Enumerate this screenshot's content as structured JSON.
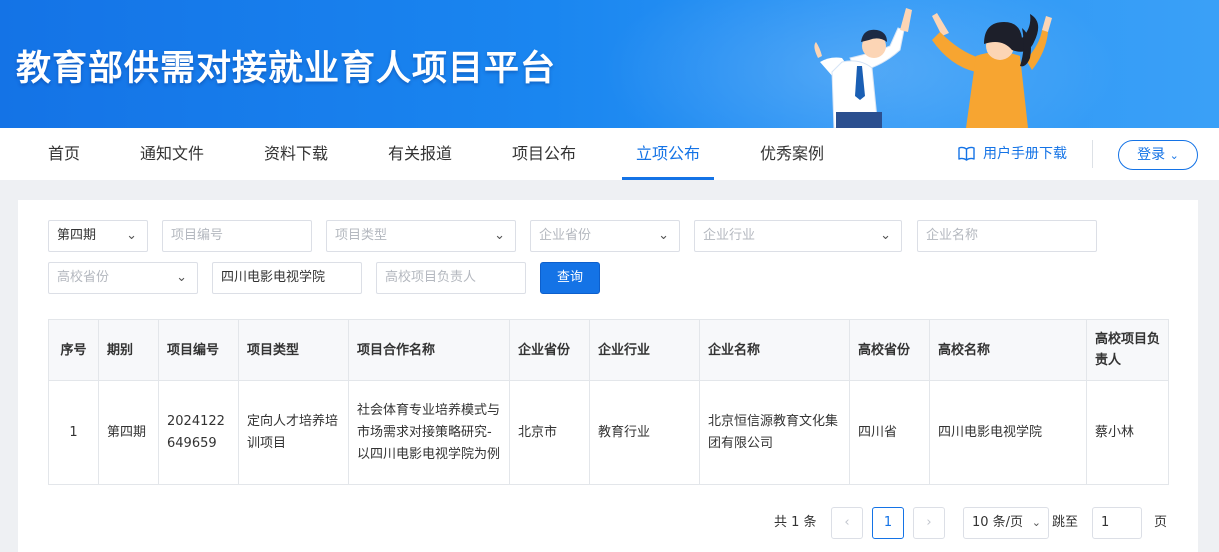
{
  "banner": {
    "title": "教育部供需对接就业育人项目平台"
  },
  "nav": {
    "items": [
      {
        "label": "首页",
        "active": false
      },
      {
        "label": "通知文件",
        "active": false
      },
      {
        "label": "资料下载",
        "active": false
      },
      {
        "label": "有关报道",
        "active": false
      },
      {
        "label": "项目公布",
        "active": false
      },
      {
        "label": "立项公布",
        "active": true
      },
      {
        "label": "优秀案例",
        "active": false
      }
    ],
    "manual_label": "用户手册下载",
    "login_label": "登录"
  },
  "filters": {
    "period": "第四期",
    "project_no_placeholder": "项目编号",
    "project_type_placeholder": "项目类型",
    "company_province_placeholder": "企业省份",
    "company_industry_placeholder": "企业行业",
    "company_name_placeholder": "企业名称",
    "school_province_placeholder": "高校省份",
    "school_name_value": "四川电影电视学院",
    "leader_placeholder": "高校项目负责人",
    "query_label": "查询"
  },
  "table": {
    "headers": [
      "序号",
      "期别",
      "项目编号",
      "项目类型",
      "项目合作名称",
      "企业省份",
      "企业行业",
      "企业名称",
      "高校省份",
      "高校名称",
      "高校项目负责人"
    ],
    "rows": [
      [
        "1",
        "第四期",
        "2024122649659",
        "定向人才培养培训项目",
        "社会体育专业培养模式与市场需求对接策略研究-以四川电影电视学院为例",
        "北京市",
        "教育行业",
        "北京恒信源教育文化集团有限公司",
        "四川省",
        "四川电影电视学院",
        "蔡小林"
      ]
    ]
  },
  "pagination": {
    "total_label": "共 1 条",
    "current_page": "1",
    "page_size": "10 条/页",
    "jump_label": "跳至",
    "jump_value": "1",
    "page_suffix": "页"
  },
  "colors": {
    "accent": "#1473e6",
    "banner_start": "#1473e6",
    "banner_end": "#3aa0f7"
  }
}
